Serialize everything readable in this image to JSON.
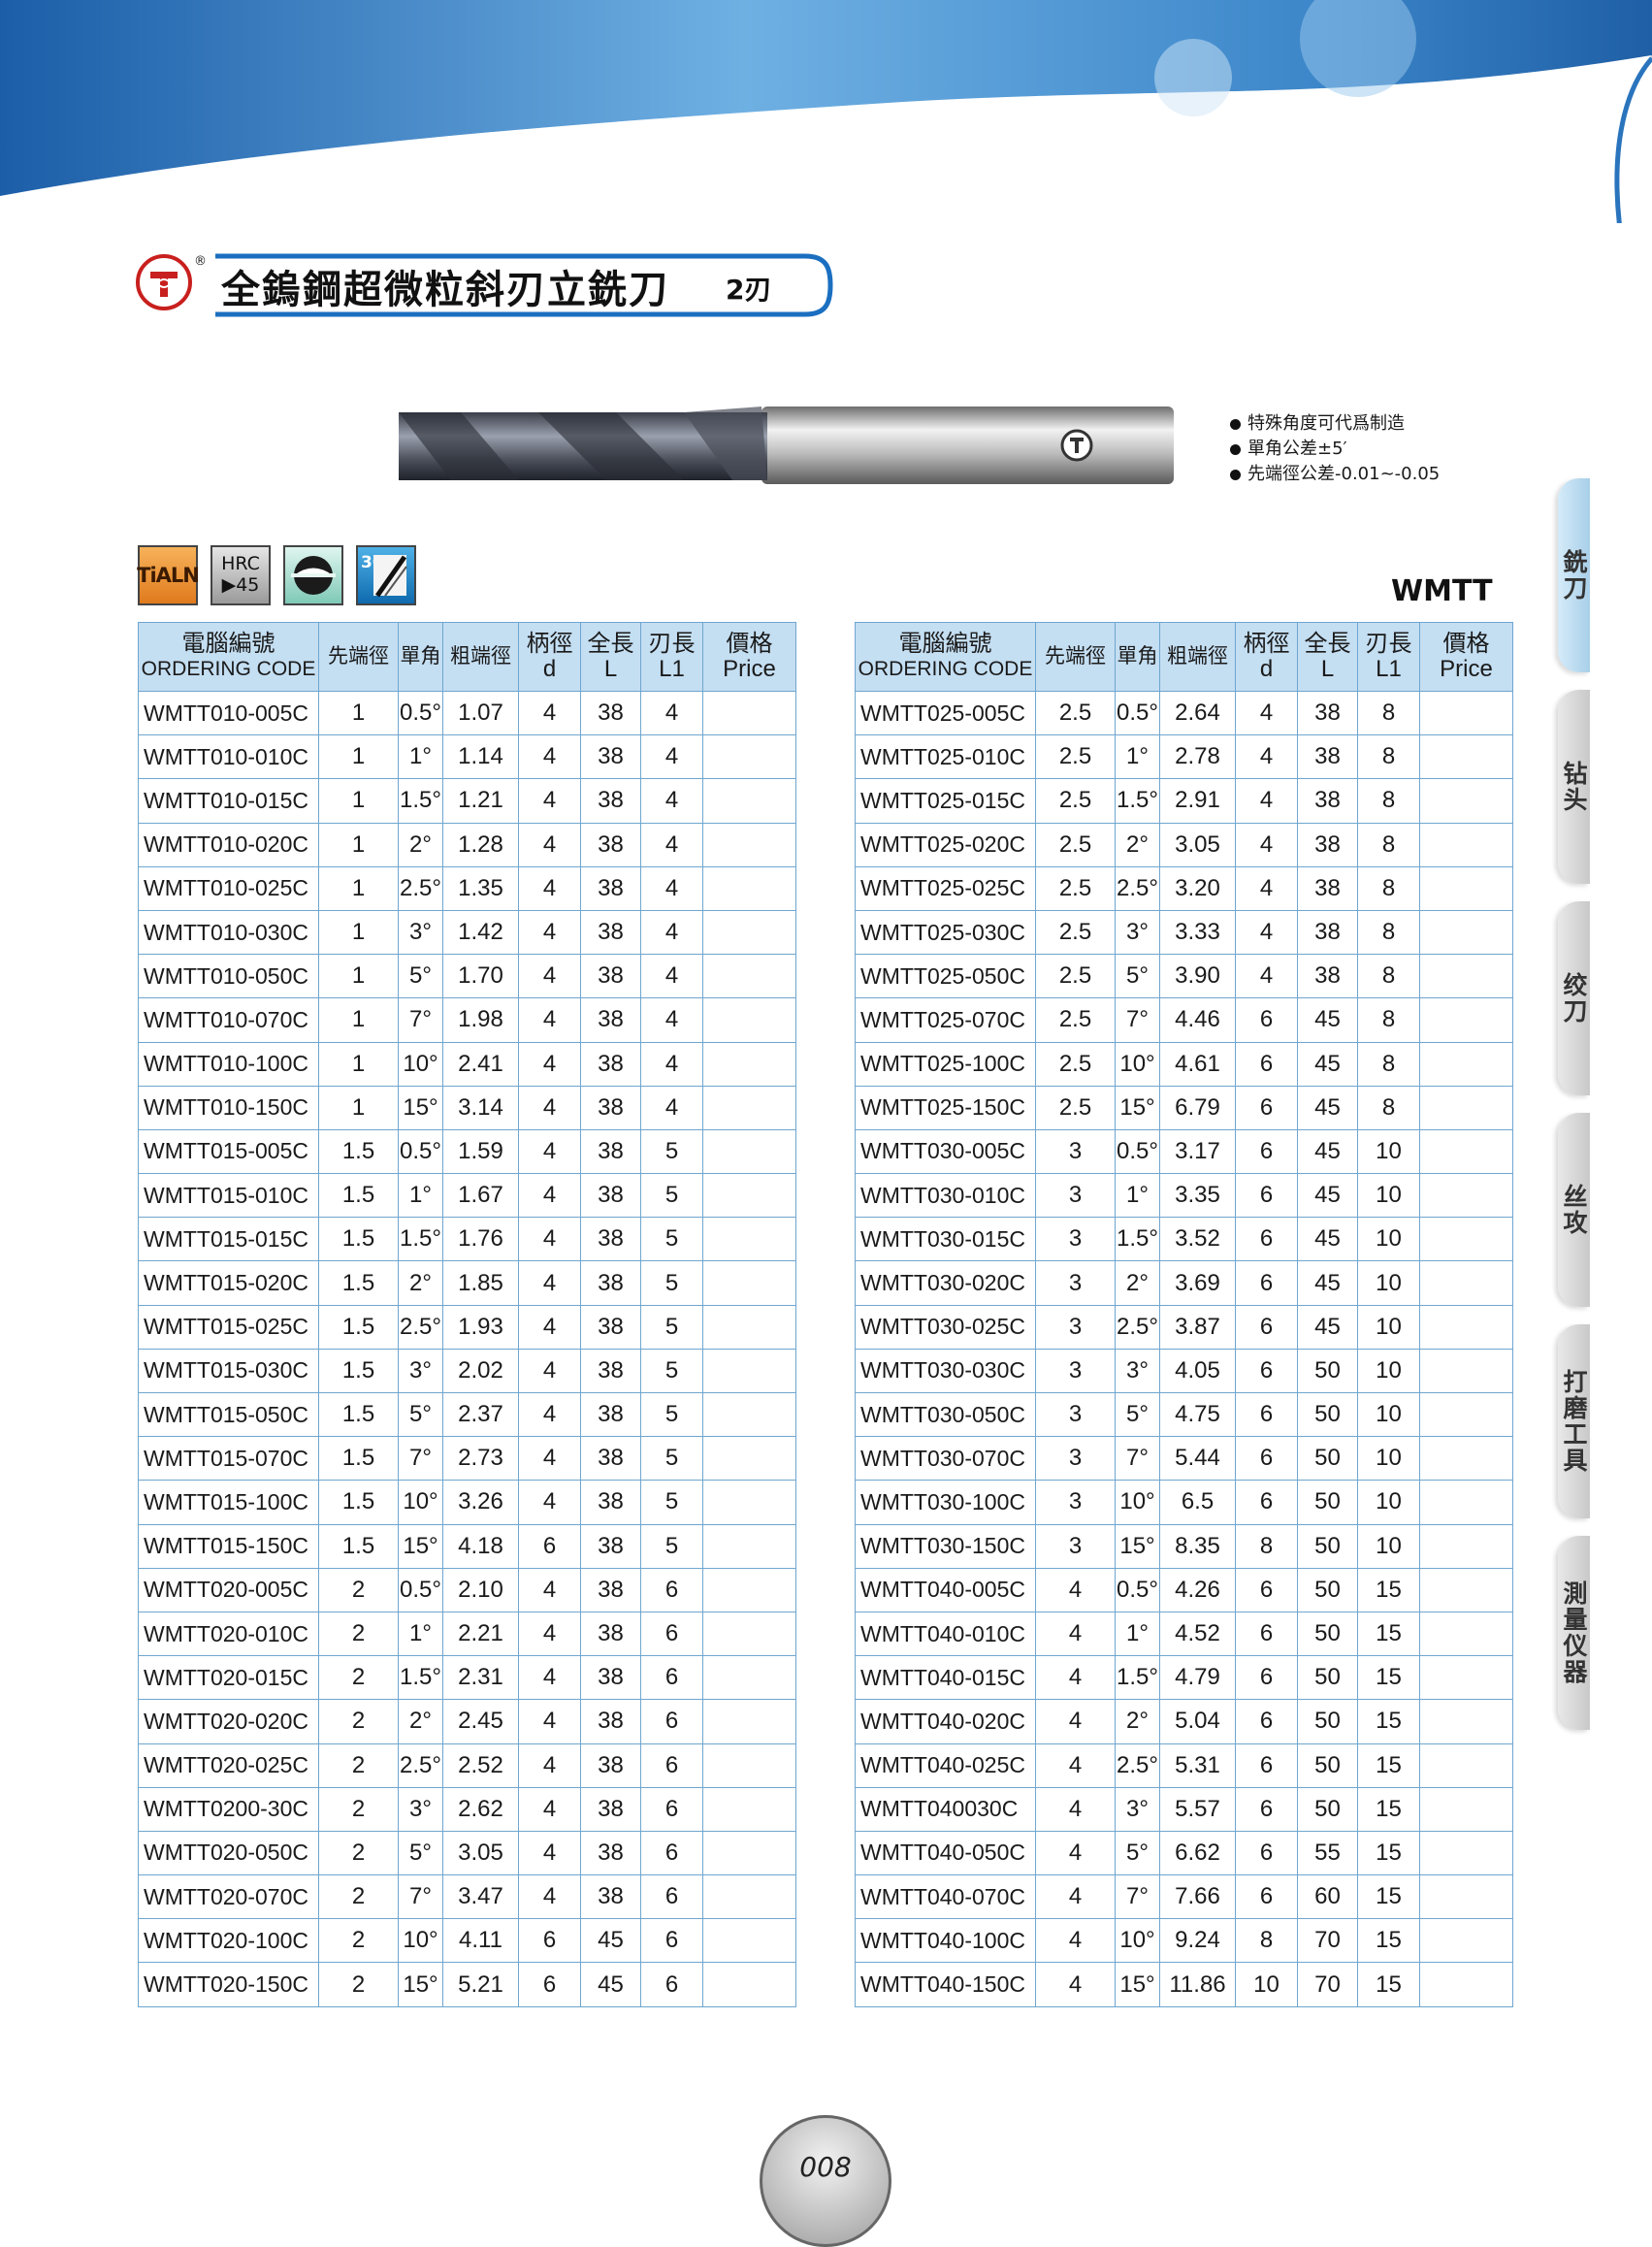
{
  "title": {
    "main": "全鎢鋼超微粒斜刃立銑刀",
    "sub": "2刃",
    "reg_mark": "®"
  },
  "notes": [
    "特殊角度可代爲制造",
    "單角公差±5′",
    "先端徑公差-0.01~-0.05"
  ],
  "icons": {
    "coating": "TiALN",
    "hrc_label": "HRC",
    "hrc_value": "▶45",
    "helix": "30°"
  },
  "series_code": "WMTT",
  "headers": {
    "code": [
      "電腦編號",
      "ORDERING CODE"
    ],
    "tip_dia": "先端徑",
    "angle": "單角",
    "rough_dia": "粗端徑",
    "shank": [
      "柄徑",
      "d"
    ],
    "length": [
      "全長",
      "L"
    ],
    "flute": [
      "刃長",
      "L1"
    ],
    "price": [
      "價格",
      "Price"
    ]
  },
  "table_left": [
    [
      "WMTT010-005C",
      "1",
      "0.5°",
      "1.07",
      "4",
      "38",
      "4"
    ],
    [
      "WMTT010-010C",
      "1",
      "1°",
      "1.14",
      "4",
      "38",
      "4"
    ],
    [
      "WMTT010-015C",
      "1",
      "1.5°",
      "1.21",
      "4",
      "38",
      "4"
    ],
    [
      "WMTT010-020C",
      "1",
      "2°",
      "1.28",
      "4",
      "38",
      "4"
    ],
    [
      "WMTT010-025C",
      "1",
      "2.5°",
      "1.35",
      "4",
      "38",
      "4"
    ],
    [
      "WMTT010-030C",
      "1",
      "3°",
      "1.42",
      "4",
      "38",
      "4"
    ],
    [
      "WMTT010-050C",
      "1",
      "5°",
      "1.70",
      "4",
      "38",
      "4"
    ],
    [
      "WMTT010-070C",
      "1",
      "7°",
      "1.98",
      "4",
      "38",
      "4"
    ],
    [
      "WMTT010-100C",
      "1",
      "10°",
      "2.41",
      "4",
      "38",
      "4"
    ],
    [
      "WMTT010-150C",
      "1",
      "15°",
      "3.14",
      "4",
      "38",
      "4"
    ],
    [
      "WMTT015-005C",
      "1.5",
      "0.5°",
      "1.59",
      "4",
      "38",
      "5"
    ],
    [
      "WMTT015-010C",
      "1.5",
      "1°",
      "1.67",
      "4",
      "38",
      "5"
    ],
    [
      "WMTT015-015C",
      "1.5",
      "1.5°",
      "1.76",
      "4",
      "38",
      "5"
    ],
    [
      "WMTT015-020C",
      "1.5",
      "2°",
      "1.85",
      "4",
      "38",
      "5"
    ],
    [
      "WMTT015-025C",
      "1.5",
      "2.5°",
      "1.93",
      "4",
      "38",
      "5"
    ],
    [
      "WMTT015-030C",
      "1.5",
      "3°",
      "2.02",
      "4",
      "38",
      "5"
    ],
    [
      "WMTT015-050C",
      "1.5",
      "5°",
      "2.37",
      "4",
      "38",
      "5"
    ],
    [
      "WMTT015-070C",
      "1.5",
      "7°",
      "2.73",
      "4",
      "38",
      "5"
    ],
    [
      "WMTT015-100C",
      "1.5",
      "10°",
      "3.26",
      "4",
      "38",
      "5"
    ],
    [
      "WMTT015-150C",
      "1.5",
      "15°",
      "4.18",
      "6",
      "38",
      "5"
    ],
    [
      "WMTT020-005C",
      "2",
      "0.5°",
      "2.10",
      "4",
      "38",
      "6"
    ],
    [
      "WMTT020-010C",
      "2",
      "1°",
      "2.21",
      "4",
      "38",
      "6"
    ],
    [
      "WMTT020-015C",
      "2",
      "1.5°",
      "2.31",
      "4",
      "38",
      "6"
    ],
    [
      "WMTT020-020C",
      "2",
      "2°",
      "2.45",
      "4",
      "38",
      "6"
    ],
    [
      "WMTT020-025C",
      "2",
      "2.5°",
      "2.52",
      "4",
      "38",
      "6"
    ],
    [
      "WMTT0200-30C",
      "2",
      "3°",
      "2.62",
      "4",
      "38",
      "6"
    ],
    [
      "WMTT020-050C",
      "2",
      "5°",
      "3.05",
      "4",
      "38",
      "6"
    ],
    [
      "WMTT020-070C",
      "2",
      "7°",
      "3.47",
      "4",
      "38",
      "6"
    ],
    [
      "WMTT020-100C",
      "2",
      "10°",
      "4.11",
      "6",
      "45",
      "6"
    ],
    [
      "WMTT020-150C",
      "2",
      "15°",
      "5.21",
      "6",
      "45",
      "6"
    ]
  ],
  "table_right": [
    [
      "WMTT025-005C",
      "2.5",
      "0.5°",
      "2.64",
      "4",
      "38",
      "8"
    ],
    [
      "WMTT025-010C",
      "2.5",
      "1°",
      "2.78",
      "4",
      "38",
      "8"
    ],
    [
      "WMTT025-015C",
      "2.5",
      "1.5°",
      "2.91",
      "4",
      "38",
      "8"
    ],
    [
      "WMTT025-020C",
      "2.5",
      "2°",
      "3.05",
      "4",
      "38",
      "8"
    ],
    [
      "WMTT025-025C",
      "2.5",
      "2.5°",
      "3.20",
      "4",
      "38",
      "8"
    ],
    [
      "WMTT025-030C",
      "2.5",
      "3°",
      "3.33",
      "4",
      "38",
      "8"
    ],
    [
      "WMTT025-050C",
      "2.5",
      "5°",
      "3.90",
      "4",
      "38",
      "8"
    ],
    [
      "WMTT025-070C",
      "2.5",
      "7°",
      "4.46",
      "6",
      "45",
      "8"
    ],
    [
      "WMTT025-100C",
      "2.5",
      "10°",
      "4.61",
      "6",
      "45",
      "8"
    ],
    [
      "WMTT025-150C",
      "2.5",
      "15°",
      "6.79",
      "6",
      "45",
      "8"
    ],
    [
      "WMTT030-005C",
      "3",
      "0.5°",
      "3.17",
      "6",
      "45",
      "10"
    ],
    [
      "WMTT030-010C",
      "3",
      "1°",
      "3.35",
      "6",
      "45",
      "10"
    ],
    [
      "WMTT030-015C",
      "3",
      "1.5°",
      "3.52",
      "6",
      "45",
      "10"
    ],
    [
      "WMTT030-020C",
      "3",
      "2°",
      "3.69",
      "6",
      "45",
      "10"
    ],
    [
      "WMTT030-025C",
      "3",
      "2.5°",
      "3.87",
      "6",
      "45",
      "10"
    ],
    [
      "WMTT030-030C",
      "3",
      "3°",
      "4.05",
      "6",
      "50",
      "10"
    ],
    [
      "WMTT030-050C",
      "3",
      "5°",
      "4.75",
      "6",
      "50",
      "10"
    ],
    [
      "WMTT030-070C",
      "3",
      "7°",
      "5.44",
      "6",
      "50",
      "10"
    ],
    [
      "WMTT030-100C",
      "3",
      "10°",
      "6.5",
      "6",
      "50",
      "10"
    ],
    [
      "WMTT030-150C",
      "3",
      "15°",
      "8.35",
      "8",
      "50",
      "10"
    ],
    [
      "WMTT040-005C",
      "4",
      "0.5°",
      "4.26",
      "6",
      "50",
      "15"
    ],
    [
      "WMTT040-010C",
      "4",
      "1°",
      "4.52",
      "6",
      "50",
      "15"
    ],
    [
      "WMTT040-015C",
      "4",
      "1.5°",
      "4.79",
      "6",
      "50",
      "15"
    ],
    [
      "WMTT040-020C",
      "4",
      "2°",
      "5.04",
      "6",
      "50",
      "15"
    ],
    [
      "WMTT040-025C",
      "4",
      "2.5°",
      "5.31",
      "6",
      "50",
      "15"
    ],
    [
      "WMTT040030C",
      "4",
      "3°",
      "5.57",
      "6",
      "50",
      "15"
    ],
    [
      "WMTT040-050C",
      "4",
      "5°",
      "6.62",
      "6",
      "55",
      "15"
    ],
    [
      "WMTT040-070C",
      "4",
      "7°",
      "7.66",
      "6",
      "60",
      "15"
    ],
    [
      "WMTT040-100C",
      "4",
      "10°",
      "9.24",
      "8",
      "70",
      "15"
    ],
    [
      "WMTT040-150C",
      "4",
      "15°",
      "11.86",
      "10",
      "70",
      "15"
    ]
  ],
  "side_tabs": [
    "銑刀",
    "钻头",
    "绞刀",
    "丝攻",
    "打磨工具",
    "測量仪器"
  ],
  "page_number": "008",
  "colors": {
    "table_border": "#6fa6cf",
    "header_fill": "#c4def2",
    "banner_blue": "#1d6fb8"
  }
}
